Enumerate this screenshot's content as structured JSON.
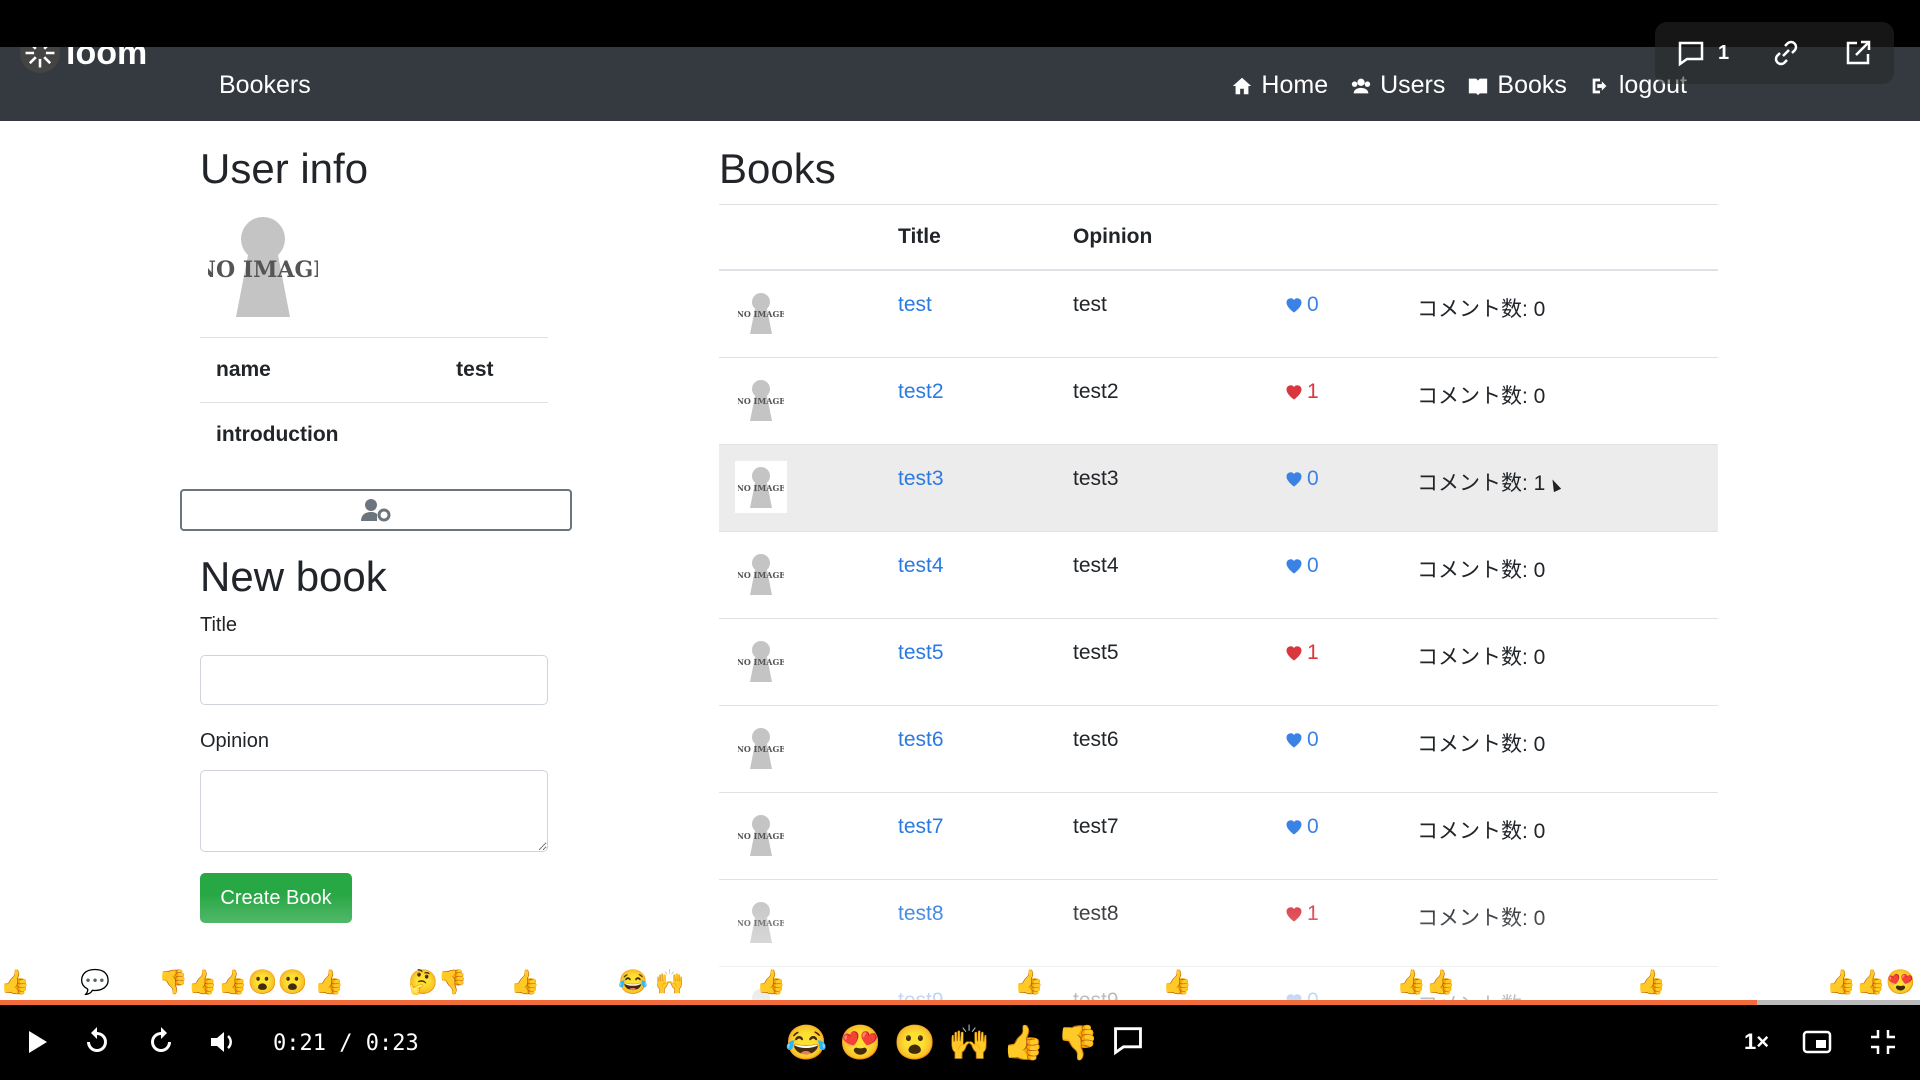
{
  "navbar": {
    "brand": "Bookers",
    "links": [
      {
        "label": "Home",
        "icon": "home-icon"
      },
      {
        "label": "Users",
        "icon": "users-icon"
      },
      {
        "label": "Books",
        "icon": "book-icon"
      },
      {
        "label": "logout",
        "icon": "logout-icon"
      }
    ]
  },
  "user_info": {
    "title": "User info",
    "rows": [
      {
        "label": "name",
        "value": "test"
      },
      {
        "label": "introduction",
        "value": ""
      }
    ]
  },
  "new_book": {
    "title": "New book",
    "title_label": "Title",
    "title_value": "",
    "opinion_label": "Opinion",
    "opinion_value": "",
    "submit_label": "Create Book"
  },
  "books": {
    "title": "Books",
    "headers": [
      "",
      "Title",
      "Opinion",
      "",
      ""
    ],
    "rows": [
      {
        "title": "test",
        "opinion": "test",
        "likes": "0",
        "liked": false,
        "comments": "コメント数: 0"
      },
      {
        "title": "test2",
        "opinion": "test2",
        "likes": "1",
        "liked": true,
        "comments": "コメント数: 0"
      },
      {
        "title": "test3",
        "opinion": "test3",
        "likes": "0",
        "liked": false,
        "comments": "コメント数: 1"
      },
      {
        "title": "test4",
        "opinion": "test4",
        "likes": "0",
        "liked": false,
        "comments": "コメント数: 0"
      },
      {
        "title": "test5",
        "opinion": "test5",
        "likes": "1",
        "liked": true,
        "comments": "コメント数: 0"
      },
      {
        "title": "test6",
        "opinion": "test6",
        "likes": "0",
        "liked": false,
        "comments": "コメント数: 0"
      },
      {
        "title": "test7",
        "opinion": "test7",
        "likes": "0",
        "liked": false,
        "comments": "コメント数: 0"
      },
      {
        "title": "test8",
        "opinion": "test8",
        "likes": "1",
        "liked": true,
        "comments": "コメント数: 0"
      },
      {
        "title": "test9",
        "opinion": "test9",
        "likes": "0",
        "liked": false,
        "comments": "コメント数"
      }
    ]
  },
  "player": {
    "logo": "loom",
    "comment_count": "1",
    "current_time": "0:21",
    "duration": "0:23",
    "time_display": "0:21 / 0:23",
    "progress": 0.915,
    "speed": "1×",
    "reaction_emojis": [
      "😂",
      "😍",
      "😮",
      "🙌",
      "👍",
      "👎"
    ],
    "accent_color": "#f26b3a"
  }
}
